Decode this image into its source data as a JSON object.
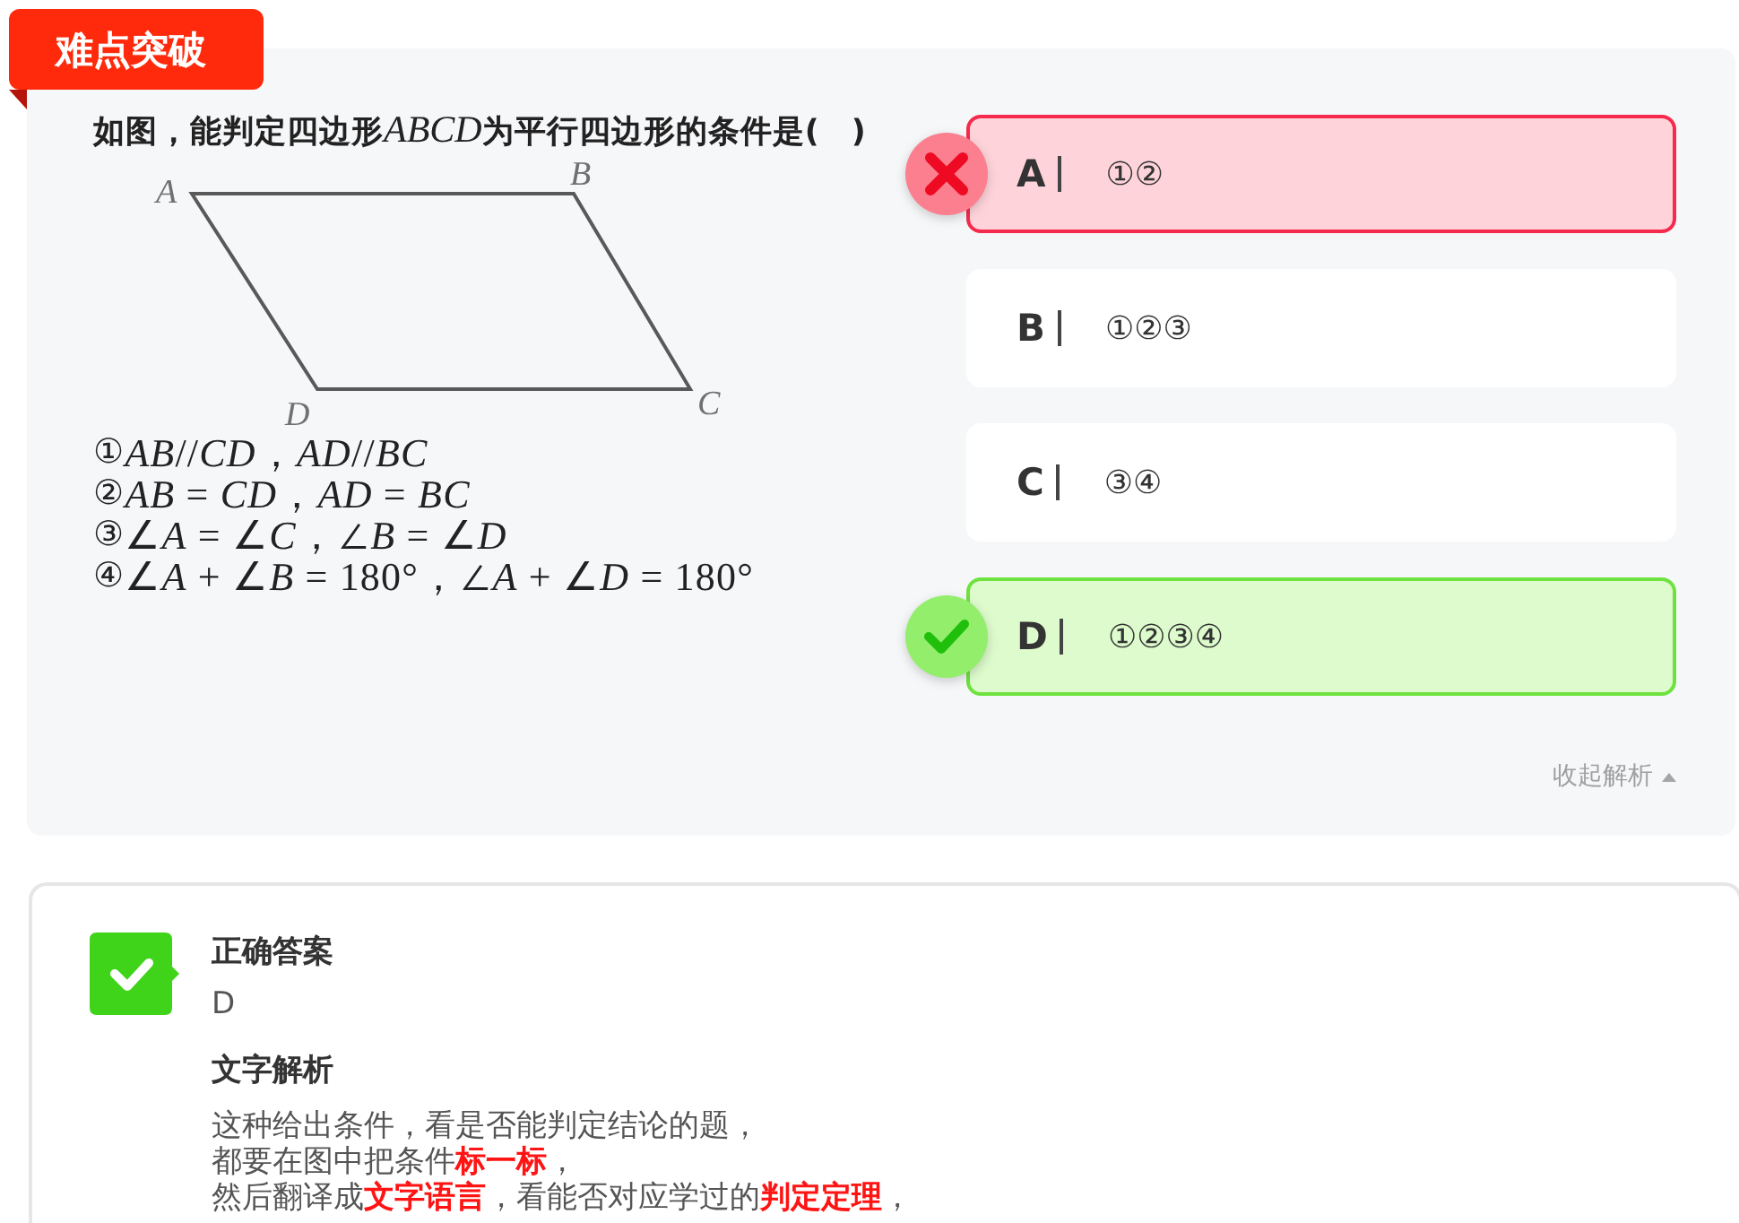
{
  "badge": {
    "label": "难点突破"
  },
  "question": {
    "parts": [
      {
        "kind": "text",
        "value": "如图，能判定四边形"
      },
      {
        "kind": "math",
        "value": "ABCD"
      },
      {
        "kind": "text",
        "value": "为平行四边形的条件是(　)"
      }
    ],
    "figure": {
      "vertex_labels": [
        "A",
        "B",
        "C",
        "D"
      ]
    },
    "conditions": [
      {
        "marker": "①",
        "formula": "*AB*//*CD*，*AD*//*BC*"
      },
      {
        "marker": "②",
        "formula": "*AB* = *CD*，*AD* = *BC*"
      },
      {
        "marker": "③",
        "formula": "∠*A* = ∠*C*，∠*B* = ∠*D*"
      },
      {
        "marker": "④",
        "formula": "∠*A* + ∠*B* = 180°，∠*A* + ∠*D* = 180°"
      }
    ]
  },
  "options": [
    {
      "letter": "A",
      "text": "①②",
      "kind": "wrong"
    },
    {
      "letter": "B",
      "text": "①②③",
      "kind": "plain"
    },
    {
      "letter": "C",
      "text": "③④",
      "kind": "plain"
    },
    {
      "letter": "D",
      "text": "①②③④",
      "kind": "correct"
    }
  ],
  "collapse_link": {
    "label": "收起解析"
  },
  "answer_card": {
    "title": "正确答案",
    "answer": "D",
    "analysis_title": "文字解析",
    "analysis_lines": [
      "这种给出条件，看是否能判定结论的题，",
      "都要在图中把条件**标一标**，",
      "然后翻译成**文字语言**，看能否对应学过的**判定定理**，"
    ]
  }
}
